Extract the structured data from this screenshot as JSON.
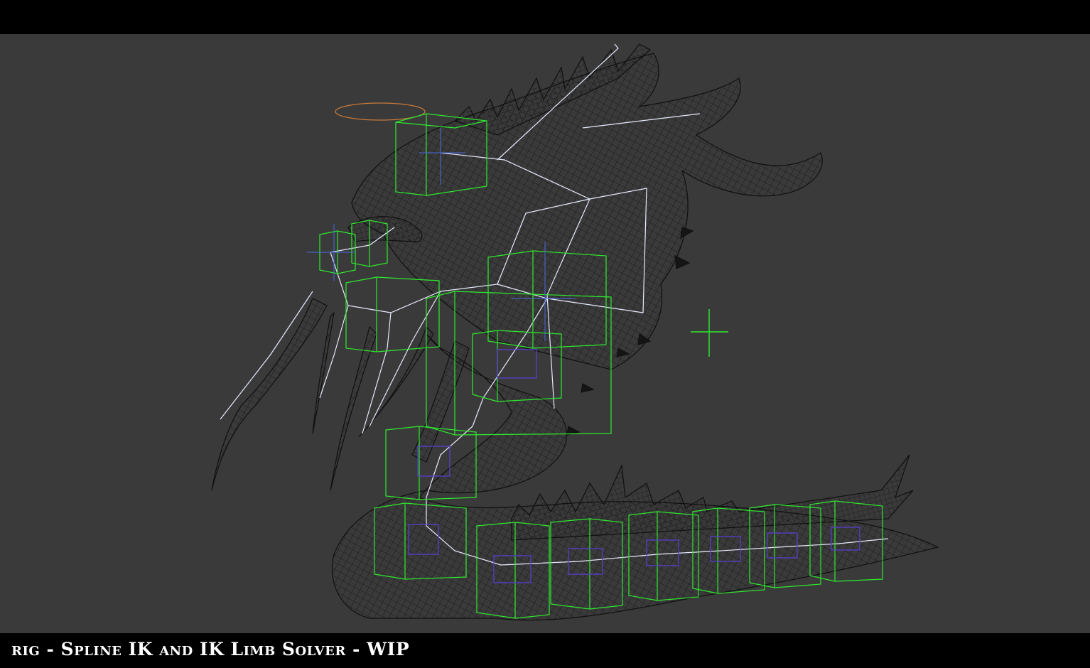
{
  "caption": "rig - Spline IK and IK Limb Solver - WIP",
  "colors": {
    "viewport_bg": "#3a3a3a",
    "wireframe": "#111111",
    "bones": "#e8ecff",
    "controls": "#2eea2e",
    "spline_controls": "#5a3ccf",
    "selection_circle": "#c87a3a"
  },
  "scene": {
    "objects": [
      "creature-wireframe-mesh",
      "spline-ik-chain",
      "ik-limb-solver",
      "point-helper"
    ]
  }
}
